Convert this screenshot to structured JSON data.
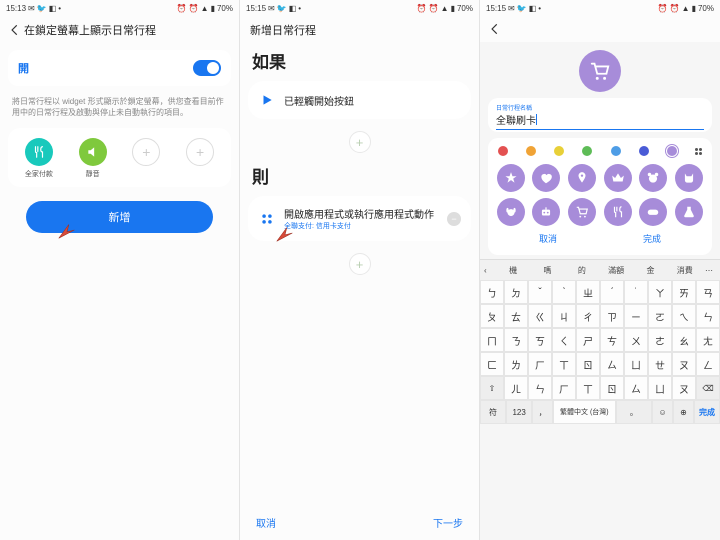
{
  "statusbar": {
    "time1": "15:13",
    "time2": "15:15",
    "time3": "15:15",
    "battery": "70%"
  },
  "s1": {
    "header_title": "在鎖定螢幕上顯示日常行程",
    "toggle_label": "開",
    "desc": "將日常行程以 widget 形式顯示於鎖定螢幕，供您查看目前作用中的日常行程及啟動與停止未自動執行的項目。",
    "quick": {
      "a": "全家付款",
      "b": "靜音"
    },
    "add_label": "新增"
  },
  "s2": {
    "header_title": "新增日常行程",
    "if_label": "如果",
    "if_item": "已輕觸開始按鈕",
    "then_label": "則",
    "then_item": "開啟應用程式或執行應用程式動作",
    "then_sub": "全聯支付: 信用卡支付",
    "cancel": "取消",
    "next": "下一步"
  },
  "s3": {
    "name_caption": "日常行程名稱",
    "name_value": "全聯刷卡",
    "colors": [
      "#e35151",
      "#f0a336",
      "#e8d038",
      "#5ebc57",
      "#4e9de6",
      "#4a5bd6",
      "#a78cd9"
    ],
    "cancel": "取消",
    "done": "完成",
    "sugg": [
      "機",
      "嗎",
      "的",
      "滿額",
      "金",
      "消費"
    ],
    "kb_rows": [
      [
        "ㄅ",
        "ㄉ",
        "ˇ",
        "ˋ",
        "ㄓ",
        "ˊ",
        "˙",
        "ㄚ",
        "ㄞ",
        "ㄢ"
      ],
      [
        "ㄆ",
        "ㄊ",
        "ㄍ",
        "ㄐ",
        "ㄔ",
        "ㄗ",
        "ㄧ",
        "ㄛ",
        "ㄟ",
        "ㄣ"
      ],
      [
        "ㄇ",
        "ㄋ",
        "ㄎ",
        "ㄑ",
        "ㄕ",
        "ㄘ",
        "ㄨ",
        "ㄜ",
        "ㄠ",
        "ㄤ"
      ],
      [
        "ㄈ",
        "ㄌ",
        "ㄏ",
        "ㄒ",
        "ㄖ",
        "ㄙ",
        "ㄩ",
        "ㄝ",
        "ㄡ",
        "ㄥ"
      ]
    ],
    "kb_bot": {
      "sym": "符",
      "num": "123",
      "comma": "，",
      "space": "繁體中文 (台灣)",
      "period": "。",
      "emoji": "☺",
      "done": "完成"
    },
    "kb_special": {
      "shift": "⇧",
      "clear": "ㄦ",
      "bksp": "⌫"
    },
    "globe": "⊕"
  }
}
